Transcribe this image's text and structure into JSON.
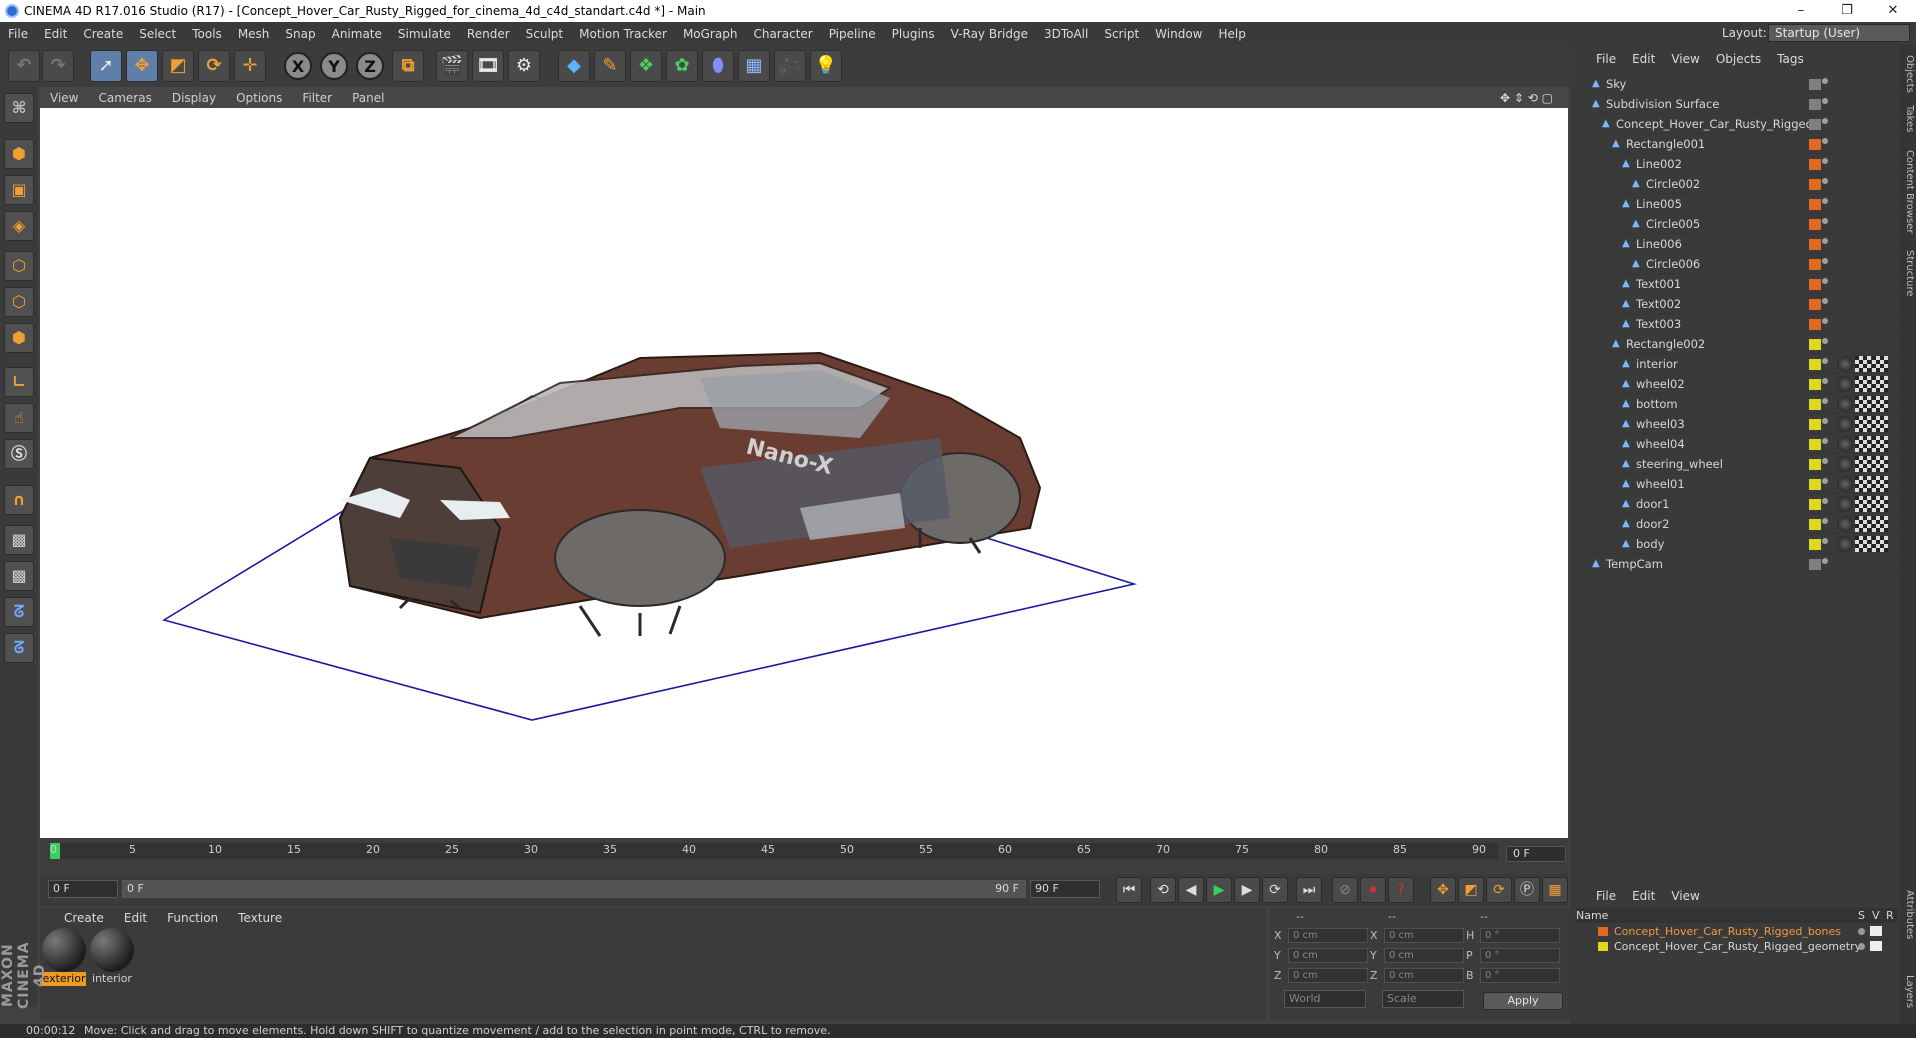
{
  "window": {
    "title": "CINEMA 4D R17.016 Studio (R17) - [Concept_Hover_Car_Rusty_Rigged_for_cinema_4d_c4d_standart.c4d *] - Main",
    "minimize": "–",
    "maximize": "❐",
    "close": "✕"
  },
  "menubar": {
    "items": [
      "File",
      "Edit",
      "Create",
      "Select",
      "Tools",
      "Mesh",
      "Snap",
      "Animate",
      "Simulate",
      "Render",
      "Sculpt",
      "Motion Tracker",
      "MoGraph",
      "Character",
      "Pipeline",
      "Plugins",
      "V-Ray Bridge",
      "3DToAll",
      "Script",
      "Window",
      "Help"
    ],
    "layout_label": "Layout:",
    "layout_value": "Startup (User)"
  },
  "toolbar": {
    "axis_x": "X",
    "axis_y": "Y",
    "axis_z": "Z"
  },
  "viewport": {
    "menu": [
      "View",
      "Cameras",
      "Display",
      "Options",
      "Filter",
      "Panel"
    ],
    "decal_text": "Nano-X"
  },
  "object_manager": {
    "menu": [
      "File",
      "Edit",
      "View",
      "Objects",
      "Tags"
    ],
    "objects": [
      {
        "name": "Sky",
        "color": "#808080"
      },
      {
        "name": "Subdivision Surface",
        "color": "#808080"
      },
      {
        "name": "Concept_Hover_Car_Rusty_Rigged",
        "color": "#808080"
      },
      {
        "name": "Rectangle001",
        "color": "#e06a20"
      },
      {
        "name": "Line002",
        "color": "#e06a20"
      },
      {
        "name": "Circle002",
        "color": "#e06a20"
      },
      {
        "name": "Line005",
        "color": "#e06a20"
      },
      {
        "name": "Circle005",
        "color": "#e06a20"
      },
      {
        "name": "Line006",
        "color": "#e06a20"
      },
      {
        "name": "Circle006",
        "color": "#e06a20"
      },
      {
        "name": "Text001",
        "color": "#e06a20"
      },
      {
        "name": "Text002",
        "color": "#e06a20"
      },
      {
        "name": "Text003",
        "color": "#e06a20"
      },
      {
        "name": "Rectangle002",
        "color": "#e0d820"
      },
      {
        "name": "interior",
        "color": "#e0d820"
      },
      {
        "name": "wheel02",
        "color": "#e0d820"
      },
      {
        "name": "bottom",
        "color": "#e0d820"
      },
      {
        "name": "wheel03",
        "color": "#e0d820"
      },
      {
        "name": "wheel04",
        "color": "#e0d820"
      },
      {
        "name": "steering_wheel",
        "color": "#e0d820"
      },
      {
        "name": "wheel01",
        "color": "#e0d820"
      },
      {
        "name": "door1",
        "color": "#e0d820"
      },
      {
        "name": "door2",
        "color": "#e0d820"
      },
      {
        "name": "body",
        "color": "#e0d820"
      },
      {
        "name": "TempCam",
        "color": "#808080"
      }
    ]
  },
  "side_tabs": [
    "Objects",
    "Takes",
    "Content Browser",
    "Structure",
    "Attributes",
    "Layers"
  ],
  "timeline": {
    "ticks": [
      "0",
      "5",
      "10",
      "15",
      "20",
      "25",
      "30",
      "35",
      "40",
      "45",
      "50",
      "55",
      "60",
      "65",
      "70",
      "75",
      "80",
      "85",
      "90"
    ],
    "current_frame": "0 F",
    "start_field": "0 F",
    "min_field": "0 F",
    "max_field": "90 F",
    "end_field": "90 F"
  },
  "material_manager": {
    "menu": [
      "Create",
      "Edit",
      "Function",
      "Texture"
    ],
    "materials": [
      {
        "name": "exterior",
        "selected": true
      },
      {
        "name": "interior",
        "selected": false
      }
    ]
  },
  "coordinates": {
    "header_dashes": [
      "--",
      "--",
      "--"
    ],
    "rows": [
      {
        "a": "X",
        "av": "0 cm",
        "b": "X",
        "bv": "0 cm",
        "c": "H",
        "cv": "0 °"
      },
      {
        "a": "Y",
        "av": "0 cm",
        "b": "Y",
        "bv": "0 cm",
        "c": "P",
        "cv": "0 °"
      },
      {
        "a": "Z",
        "av": "0 cm",
        "b": "Z",
        "bv": "0 cm",
        "c": "B",
        "cv": "0 °"
      }
    ],
    "mode1": "World",
    "mode2": "Scale",
    "apply": "Apply"
  },
  "layer_manager": {
    "menu": [
      "File",
      "Edit",
      "View"
    ],
    "header_name": "Name",
    "header_s": "S",
    "header_v": "V",
    "header_r": "R",
    "layers": [
      {
        "name": "Concept_Hover_Car_Rusty_Rigged_bones",
        "color": "#e06a20",
        "text_color": "#f09a3a"
      },
      {
        "name": "Concept_Hover_Car_Rusty_Rigged_geometry",
        "color": "#e0d820",
        "text_color": "#d7d7d7"
      }
    ]
  },
  "status": {
    "time": "00:00:12",
    "message": "Move: Click and drag to move elements. Hold down SHIFT to quantize movement / add to the selection in point mode, CTRL to remove."
  },
  "brand": "MAXON CINEMA 4D",
  "colors": {
    "accent_blue": "#5f7fa8",
    "play_green": "#37d05a",
    "record_red": "#d03030",
    "selected_material": "#f09a20"
  }
}
